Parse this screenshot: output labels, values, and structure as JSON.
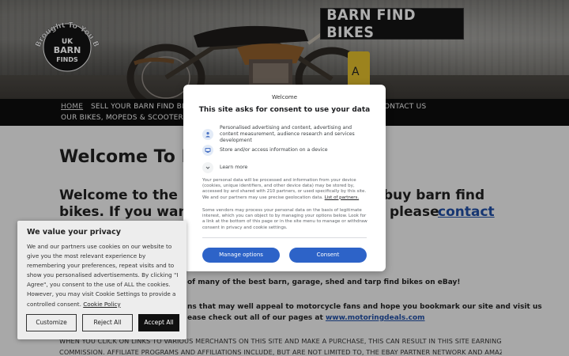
{
  "header": {
    "logo_arc_text": "Brought To You By",
    "logo_center_lines": [
      "UK",
      "BARN",
      "FINDS"
    ],
    "site_title": "BARN FIND BIKES",
    "bike_plate": "A"
  },
  "nav": {
    "items": [
      {
        "label": "HOME"
      },
      {
        "label": "SELL YOUR BARN FIND BIKE"
      },
      {
        "label": "ONTACT US"
      },
      {
        "label": "OUR BIKES, MOPEDS & SCOOTERS"
      }
    ]
  },
  "main": {
    "heading": "Welcome To B",
    "lead_left_1": "Welcome to the B",
    "lead_right_1": "buy barn find",
    "lead_left_2": "bikes. If you want",
    "lead_right_2": "please",
    "lead_link": "contact",
    "p1": "of many of the best barn, garage, shed and tarp find bikes on eBay!",
    "p2_line1": "ns that may well appeal to motorcycle fans and hope you bookmark our site and visit us",
    "p2_line2_prefix": "ease check out all of our pages at",
    "p2_link": "www.motoringdeals.com",
    "disclaimer_line1": "WHEN YOU CLICK ON LINKS TO VARIOUS MERCHANTS ON THIS SITE AND MAKE A PURCHASE, THIS CAN RESULT IN THIS SITE EARNING A",
    "disclaimer_line2": "COMMISSION. AFFILIATE PROGRAMS AND AFFILIATIONS INCLUDE, BUT ARE NOT LIMITED TO, THE EBAY PARTNER NETWORK AND AMAZON"
  },
  "consent": {
    "welcome": "Welcome",
    "title": "This site asks for consent to use your data",
    "purpose_1": "Personalised advertising and content, advertising and content measurement, audience research and services development",
    "purpose_2": "Store and/or access information on a device",
    "learn_more": "Learn more",
    "body_1": "Your personal data will be processed and information from your device (cookies, unique identifiers, and other device data) may be stored by, accessed by and shared with 210 partners, or used specifically by this site. We and our partners may use precise geolocation data.",
    "body_1_link": "List of partners.",
    "body_2": "Some vendors may process your personal data on the basis of legitimate interest, which you can object to by managing your options below. Look for a link at the bottom of this page or in the site menu to manage or withdraw consent in privacy and cookie settings.",
    "manage_label": "Manage options",
    "consent_label": "Consent",
    "accent": "#2d63c8"
  },
  "privacy": {
    "title": "We value your privacy",
    "text": "We and our partners use cookies on our website to give you the most relevant experience by remembering your preferences, repeat visits and to show you personalised advertisements. By clicking \"I Agree\", you consent to the use of ALL the cookies. However, you may visit Cookie Settings to provide a controlled consent.",
    "policy_link": "Cookie Policy",
    "customize_label": "Customize",
    "reject_label": "Reject All",
    "accept_label": "Accept All"
  }
}
